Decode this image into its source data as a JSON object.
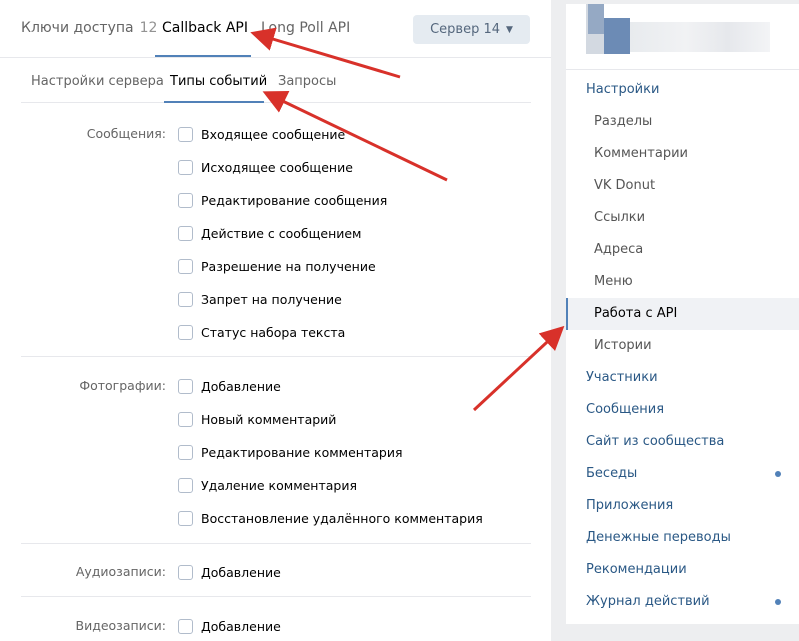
{
  "top_tabs": {
    "keys_label": "Ключи доступа",
    "keys_count": "12",
    "callback_label": "Callback API",
    "longpoll_label": "Long Poll API",
    "server_label": "Сервер 14"
  },
  "sub_tabs": {
    "settings": "Настройки сервера",
    "event_types": "Типы событий",
    "requests": "Запросы"
  },
  "sections": {
    "messages": {
      "label": "Сообщения:",
      "items": [
        "Входящее сообщение",
        "Исходящее сообщение",
        "Редактирование сообщения",
        "Действие с сообщением",
        "Разрешение на получение",
        "Запрет на получение",
        "Статус набора текста"
      ]
    },
    "photos": {
      "label": "Фотографии:",
      "items": [
        "Добавление",
        "Новый комментарий",
        "Редактирование комментария",
        "Удаление комментария",
        "Восстановление удалённого комментария"
      ]
    },
    "audio": {
      "label": "Аудиозаписи:",
      "items": [
        "Добавление"
      ]
    },
    "video": {
      "label": "Видеозаписи:",
      "items": [
        "Добавление"
      ]
    }
  },
  "nav": {
    "items": [
      "Настройки",
      "Разделы",
      "Комментарии",
      "VK Donut",
      "Ссылки",
      "Адреса",
      "Меню",
      "Работа с API",
      "Истории",
      "Участники",
      "Сообщения",
      "Сайт из сообщества",
      "Беседы",
      "Приложения",
      "Денежные переводы",
      "Рекомендации",
      "Журнал действий"
    ]
  },
  "colors": {
    "accent": "#5181b8",
    "link": "#2a5885",
    "arrow": "#d8312a"
  }
}
